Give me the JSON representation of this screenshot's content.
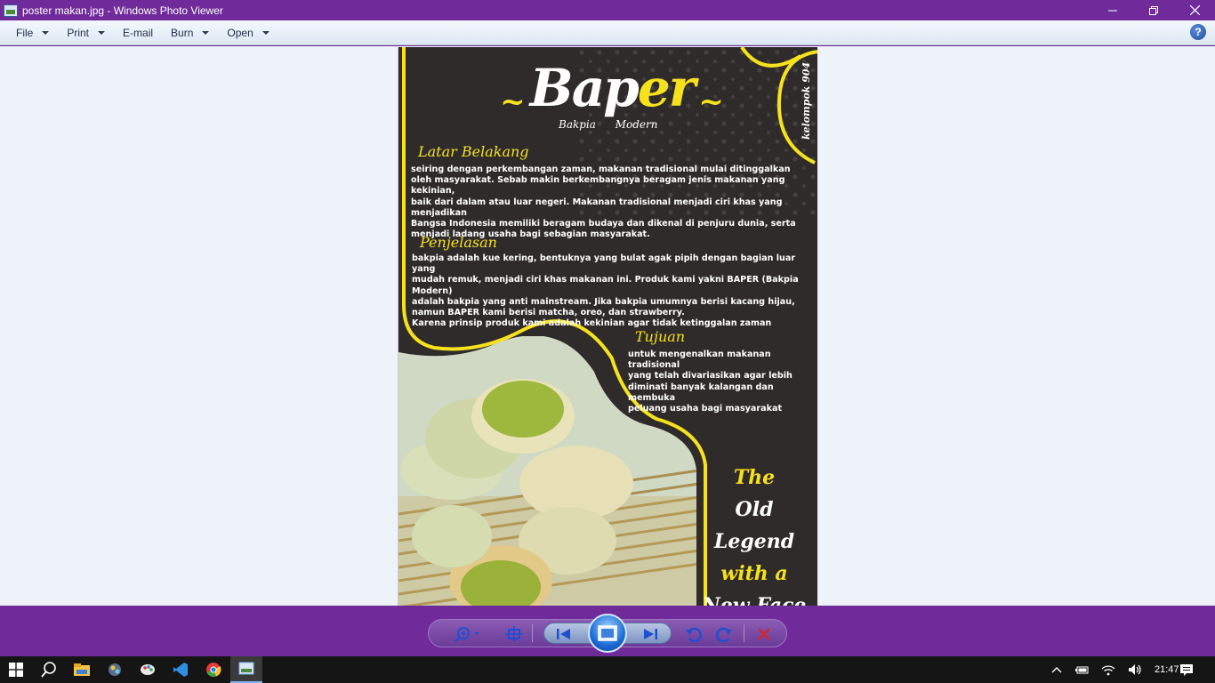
{
  "window": {
    "title": "poster makan.jpg - Windows Photo Viewer",
    "app_icon": "photo-viewer-icon"
  },
  "menu": {
    "items": [
      {
        "label": "File",
        "has_dropdown": true
      },
      {
        "label": "Print",
        "has_dropdown": true
      },
      {
        "label": "E-mail",
        "has_dropdown": false
      },
      {
        "label": "Burn",
        "has_dropdown": true
      },
      {
        "label": "Open",
        "has_dropdown": true
      }
    ],
    "help": "?"
  },
  "poster": {
    "brand_tilde_left": "~",
    "brand_main_white": "Bap",
    "brand_main_yellow": "er",
    "brand_tilde_right": "~",
    "brand_subtitle": "Bakpia Modern",
    "side_label": "kelompok 904",
    "sections": [
      {
        "heading": "Latar Belakang",
        "text": "seiring dengan perkembangan zaman, makanan tradisional mulai ditinggalkan\noleh masyarakat. Sebab makin berkembangnya beragam jenis makanan yang kekinian,\nbaik dari dalam atau luar negeri. Makanan tradisional menjadi ciri khas yang menjadikan\nBangsa Indonesia memiliki beragam budaya dan dikenal di penjuru dunia, serta\nmenjadi ladang usaha bagi sebagian masyarakat."
      },
      {
        "heading": "Penjelasan",
        "text": "bakpia adalah kue kering, bentuknya yang bulat agak pipih dengan bagian luar yang\nmudah remuk, menjadi ciri khas makanan ini. Produk kami yakni BAPER (Bakpia Modern)\nadalah bakpia yang anti mainstream. Jika bakpia umumnya berisi kacang hijau,\nnamun BAPER kami berisi matcha, oreo, dan strawberry.\nKarena prinsip produk kami adalah kekinian agar tidak ketinggalan zaman"
      },
      {
        "heading": "Tujuan",
        "text": "untuk mengenalkan makanan tradisional\nyang telah divariasikan agar lebih\ndiminati banyak kalangan dan membuka\npeluang usaha bagi masyarakat"
      }
    ],
    "tagline": [
      "The",
      "Old Legend",
      "with a",
      "New Face"
    ],
    "colors": {
      "background": "#302b2b",
      "accent": "#f5e21d",
      "text": "#ffffff"
    }
  },
  "controls": {
    "zoom": "zoom-icon",
    "actual_size": "actual-size-icon",
    "previous": "previous-icon",
    "slideshow": "slideshow-icon",
    "next": "next-icon",
    "rotate_ccw": "rotate-counterclockwise-icon",
    "rotate_cw": "rotate-clockwise-icon",
    "delete": "delete-icon"
  },
  "taskbar": {
    "clock": "21:47",
    "pinned": [
      "start-icon",
      "search-icon",
      "file-explorer-icon",
      "app-icon",
      "paint-icon",
      "vscode-icon",
      "chrome-icon",
      "photo-viewer-icon"
    ]
  }
}
